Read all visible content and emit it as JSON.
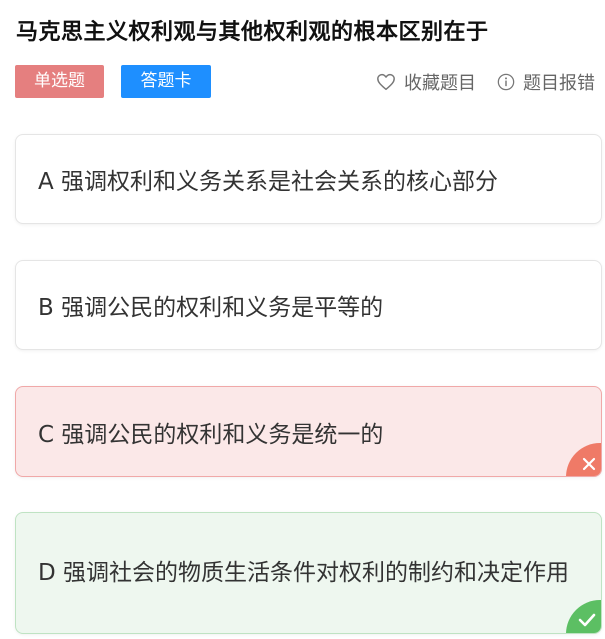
{
  "question": {
    "title": "马克思主义权利观与其他权利观的根本区别在于"
  },
  "tags": {
    "type_label": "单选题",
    "card_label": "答题卡"
  },
  "actions": {
    "favorite_label": "收藏题目",
    "report_label": "题目报错"
  },
  "options": [
    {
      "text": "A 强调权利和义务关系是社会关系的核心部分",
      "state": "normal"
    },
    {
      "text": "B 强调公民的权利和义务是平等的",
      "state": "normal"
    },
    {
      "text": "C 强调公民的权利和义务是统一的",
      "state": "wrong"
    },
    {
      "text": "D 强调社会的物质生活条件对权利的制约和决定作用",
      "state": "correct"
    }
  ],
  "colors": {
    "tag_type": "#e57f7f",
    "tag_card": "#1e8fff",
    "wrong_bg": "#fbe8e8",
    "wrong_badge": "#ef7a67",
    "correct_bg": "#eef7ef",
    "correct_badge": "#5cbf63"
  },
  "icons": {
    "favorite": "heart-outline-icon",
    "report": "info-circle-icon",
    "wrong": "close-icon",
    "correct": "checkmark-icon"
  }
}
